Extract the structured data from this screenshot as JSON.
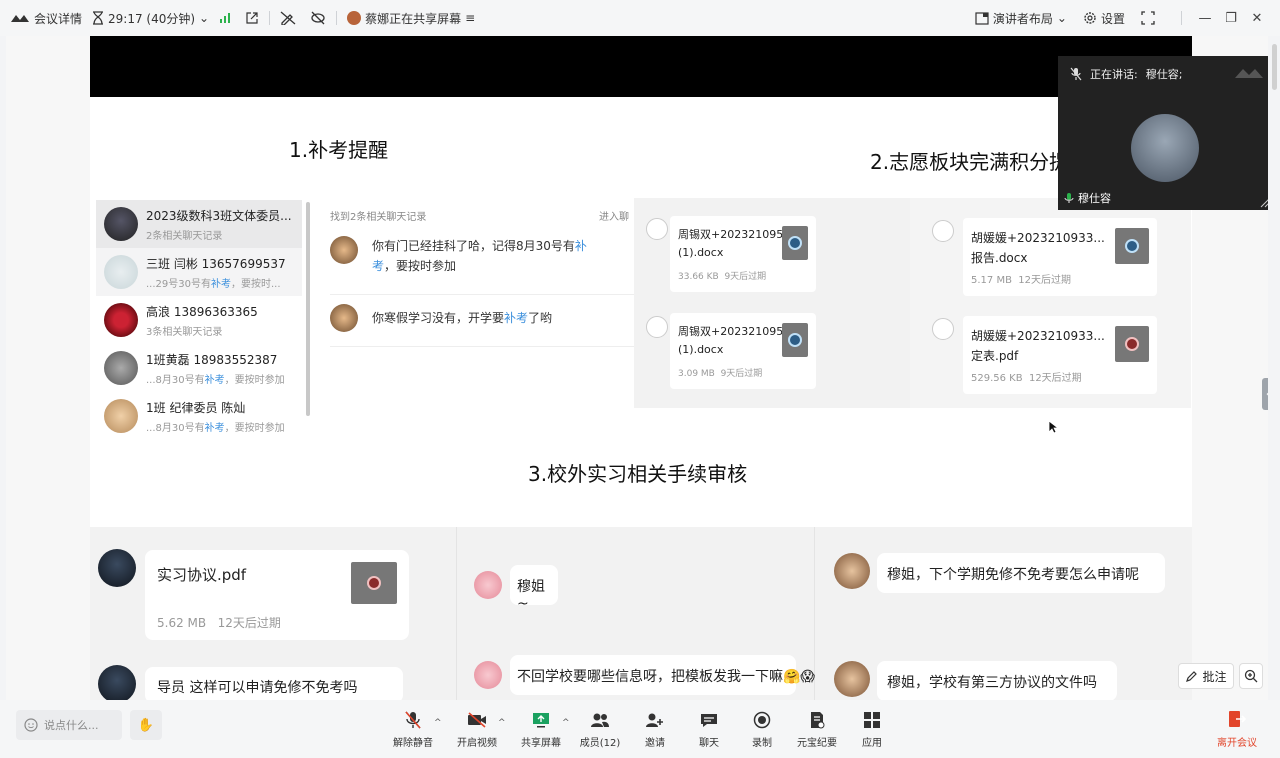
{
  "topbar": {
    "meeting_details": "会议详情",
    "timer": "29:17 (40分钟)",
    "sharing": "蔡娜正在共享屏幕",
    "layout": "演讲者布局",
    "settings": "设置"
  },
  "slide": {
    "heading1": "1.补考提醒",
    "heading2": "2.志愿板块完满积分提",
    "heading3": "3.校外实习相关手续审核"
  },
  "chat_search": {
    "found": "找到2条相关聊天记录",
    "enter": "进入聊",
    "items": [
      {
        "name": "2023级数科3班文体委员...",
        "sub": "2条相关聊天记录"
      },
      {
        "name": "三班 闫彬 13657699537",
        "sub_pre": "...29号30号有",
        "sub_hl": "补考",
        "sub_post": "，要按时..."
      },
      {
        "name": "高浪 13896363365",
        "sub": "3条相关聊天记录"
      },
      {
        "name": "1班黄磊 18983552387",
        "sub_pre": "...8月30号有",
        "sub_hl": "补考",
        "sub_post": "，要按时参加"
      },
      {
        "name": "1班 纪律委员 陈灿",
        "sub_pre": "...8月30号有",
        "sub_hl": "补考",
        "sub_post": "，要按时参加"
      }
    ],
    "messages": [
      {
        "pre": "你有门已经挂科了哈，记得8月30号有",
        "hl": "补考",
        "post": "，要按时参加"
      },
      {
        "pre": "你寒假学习没有，开学要",
        "hl": "补考",
        "post": "了哟"
      }
    ]
  },
  "files": [
    {
      "name1": "周锡双+2023210953...",
      "name2": "(1).docx",
      "size": "33.66 KB",
      "expire": "9天后过期",
      "color": "#2d5d86"
    },
    {
      "name1": "周锡双+2023210953...",
      "name2": "(1).docx",
      "size": "3.09 MB",
      "expire": "9天后过期",
      "color": "#2d5d86"
    },
    {
      "name1": "胡媛媛+2023210933...",
      "name2": "报告.docx",
      "size": "5.17 MB",
      "expire": "12天后过期",
      "color": "#2d5d86"
    },
    {
      "name1": "胡媛媛+2023210933...",
      "name2": "定表.pdf",
      "size": "529.56 KB",
      "expire": "12天后过期",
      "color": "#8a2a2a"
    }
  ],
  "speaker": {
    "label": "正在讲话:",
    "name_top": "穆仕容;",
    "name_bottom": "穆仕容"
  },
  "row2": {
    "file_name": "实习协议.pdf",
    "file_size": "5.62 MB",
    "file_expire": "12天后过期",
    "msg_guide": "导员 这样可以申请免修不免考吗",
    "msg_mu": "穆姐~",
    "msg_info": "不回学校要哪些信息呀，把模板发我一下嘛🤗😱",
    "msg_q1": "穆姐，下个学期免修不免考要怎么申请呢",
    "msg_q2": "穆姐，学校有第三方协议的文件吗"
  },
  "annotate": "批注",
  "bottombar": {
    "input_placeholder": "说点什么...",
    "tools": [
      "解除静音",
      "开启视频",
      "共享屏幕",
      "成员(12)",
      "邀请",
      "聊天",
      "录制",
      "元宝纪要",
      "应用"
    ],
    "leave": "离开会议"
  }
}
